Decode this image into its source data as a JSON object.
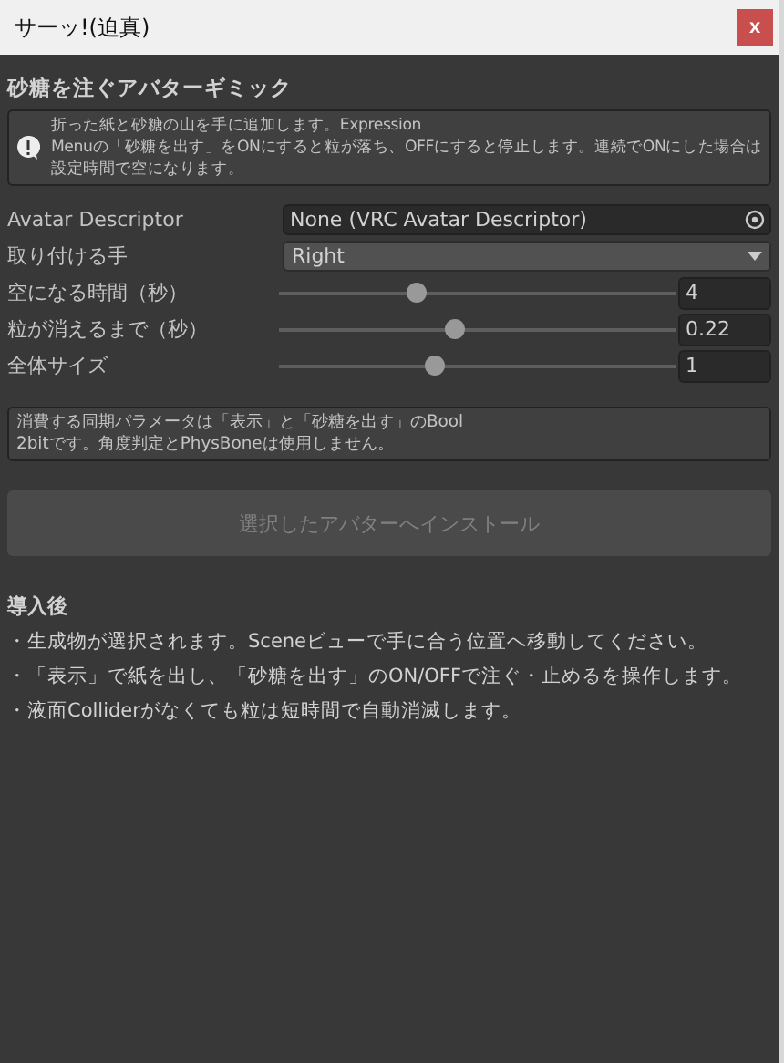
{
  "window": {
    "title": "サーッ!(迫真)",
    "close": "x"
  },
  "heading": "砂糖を注ぐアバターギミック",
  "info": {
    "lines": [
      "折った紙と砂糖の山を手に追加します。Expression",
      "Menuの「砂糖を出す」をONにすると粒が落ち、OFFにすると停止します。連続でONにした場合は",
      "設定時間で空になります。"
    ]
  },
  "fields": [
    {
      "kind": "object",
      "label": "Avatar Descriptor",
      "value": "None (VRC Avatar Descriptor)"
    },
    {
      "kind": "dropdown",
      "label": "取り付ける手",
      "value": "Right"
    },
    {
      "kind": "slider",
      "label": "空になる時間（秒）",
      "value": "4",
      "level": 0.34
    },
    {
      "kind": "slider",
      "label": "粒が消えるまで（秒）",
      "value": "0.22",
      "level": 0.44
    },
    {
      "kind": "slider",
      "label": "全体サイズ",
      "value": "1",
      "level": 0.39
    }
  ],
  "note": {
    "lines": [
      "消費する同期パラメータは「表示」と「砂糖を出す」のBool",
      "2bitです。角度判定とPhysBoneは使用しません。"
    ]
  },
  "install_button": {
    "label": "選択したアバターへインストール",
    "disabled": true
  },
  "after": {
    "title": "導入後",
    "items": [
      "・生成物が選択されます。Sceneビューで手に合う位置へ移動してください。",
      "・「表示」で紙を出し、「砂糖を出す」のON/OFFで注ぐ・止めるを操作します。",
      "・液面Colliderがなくても粒は短時間で自動消滅します。"
    ]
  }
}
